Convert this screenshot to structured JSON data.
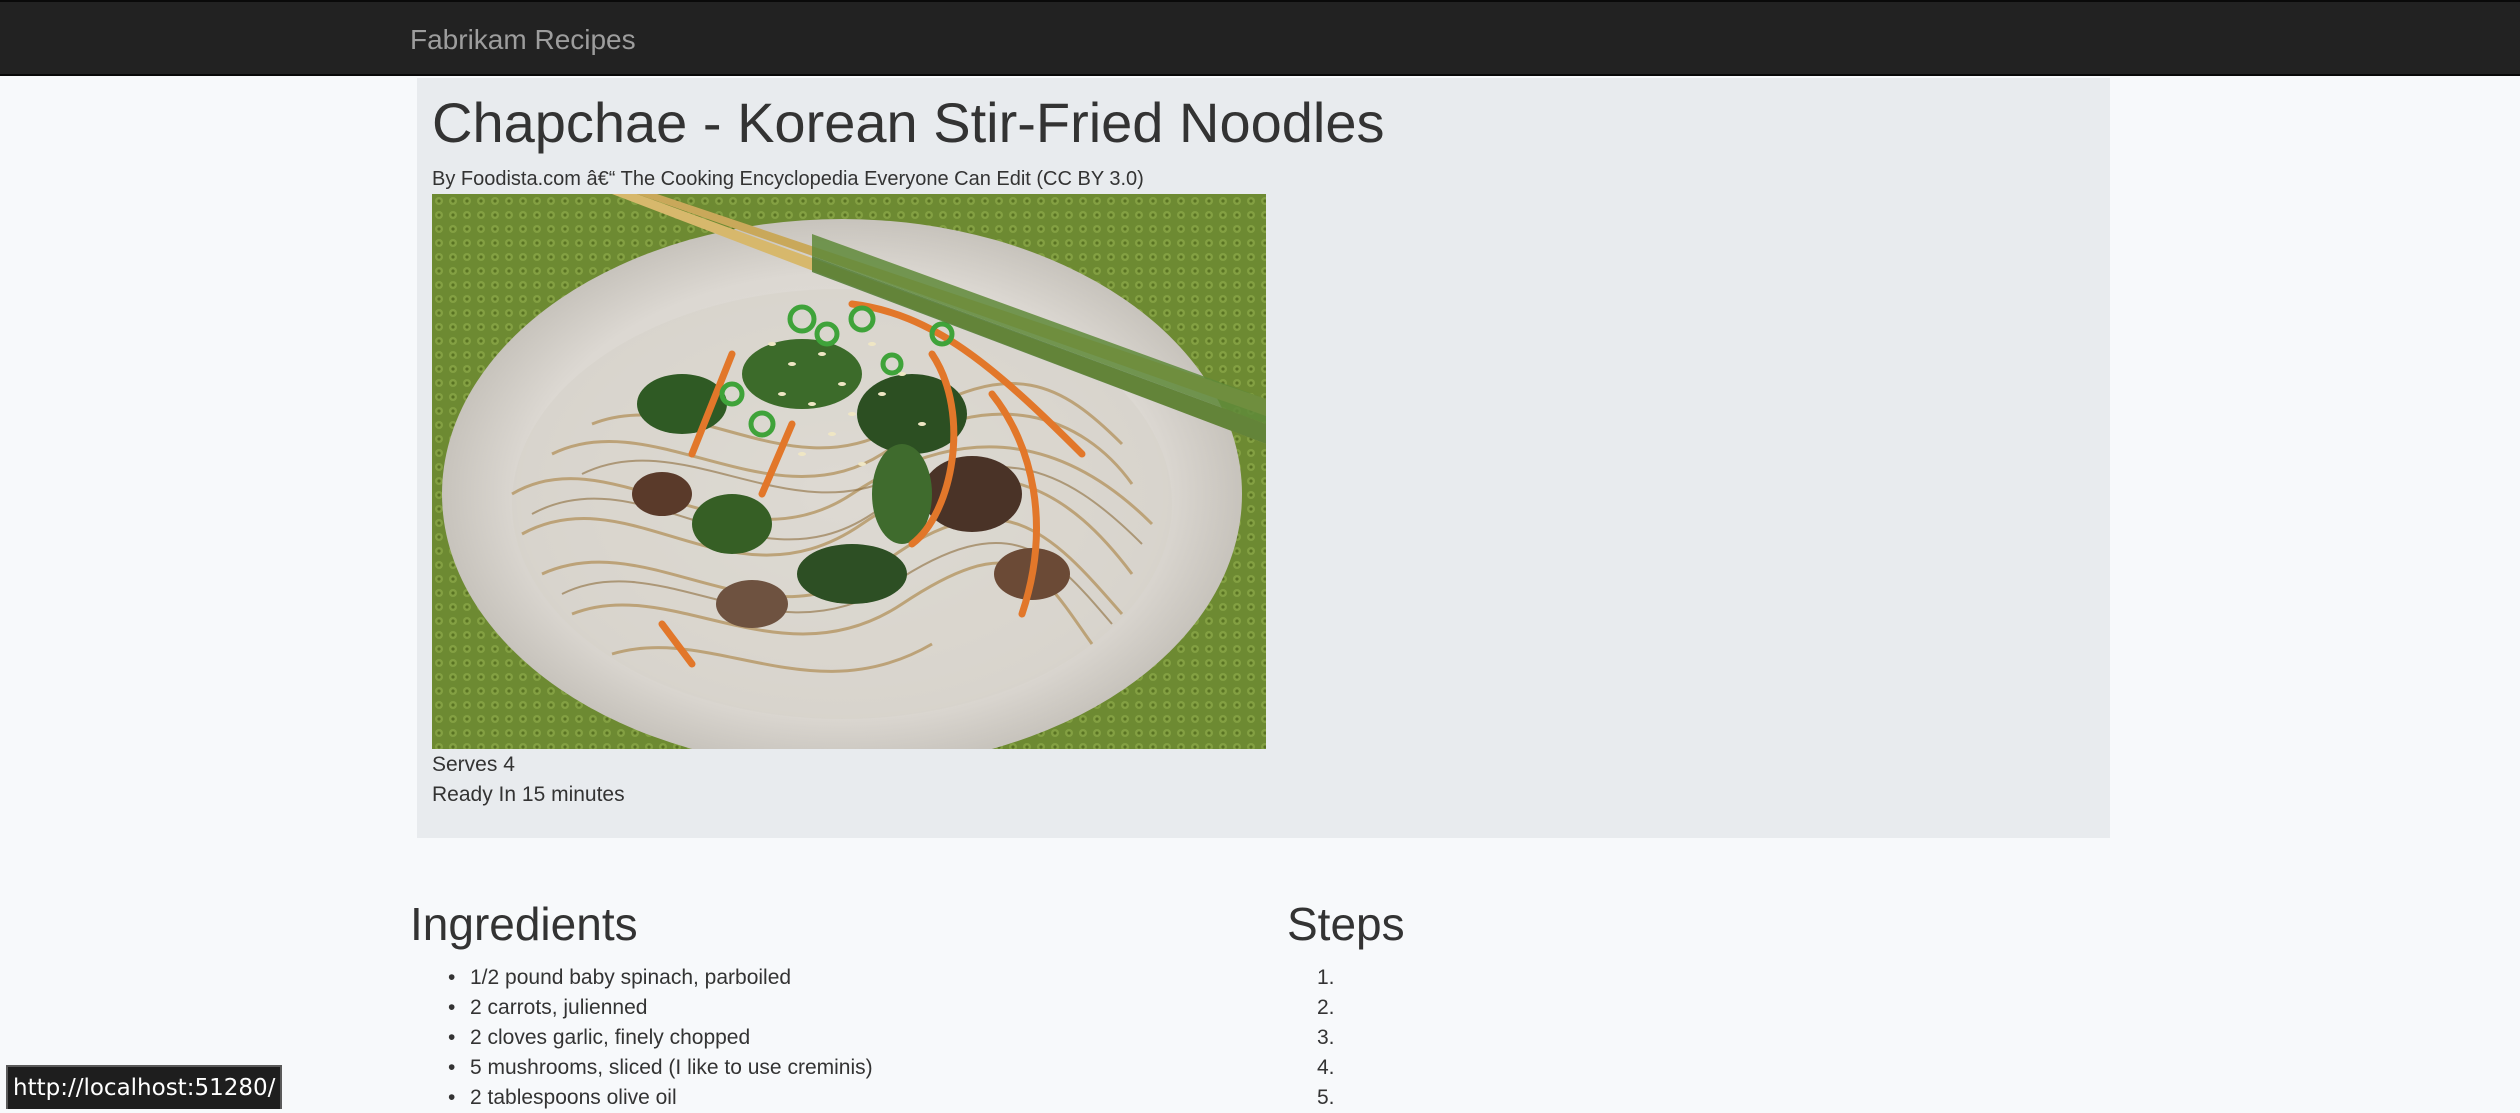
{
  "navbar": {
    "brand": "Fabrikam Recipes"
  },
  "recipe": {
    "title": "Chapchae - Korean Stir-Fried Noodles",
    "byline": "By Foodista.com â€“ The Cooking Encyclopedia Everyone Can Edit (CC BY 3.0)",
    "serves": "Serves 4",
    "ready_in": "Ready In 15 minutes"
  },
  "ingredients": {
    "heading": "Ingredients",
    "items": [
      "1/2 pound baby spinach, parboiled",
      "2 carrots, julienned",
      "2 cloves garlic, finely chopped",
      "5 mushrooms, sliced (I like to use creminis)",
      "2 tablespoons olive oil"
    ]
  },
  "steps": {
    "heading": "Steps",
    "numbers": [
      "1.",
      "2.",
      "3.",
      "4.",
      "5."
    ]
  },
  "status_bar": {
    "url": "http://localhost:51280/"
  },
  "colors": {
    "navbar": "#222222",
    "brand_text": "#9d9d9d",
    "jumbotron": "#e8ebee",
    "page_background": "#f7f9fb"
  }
}
